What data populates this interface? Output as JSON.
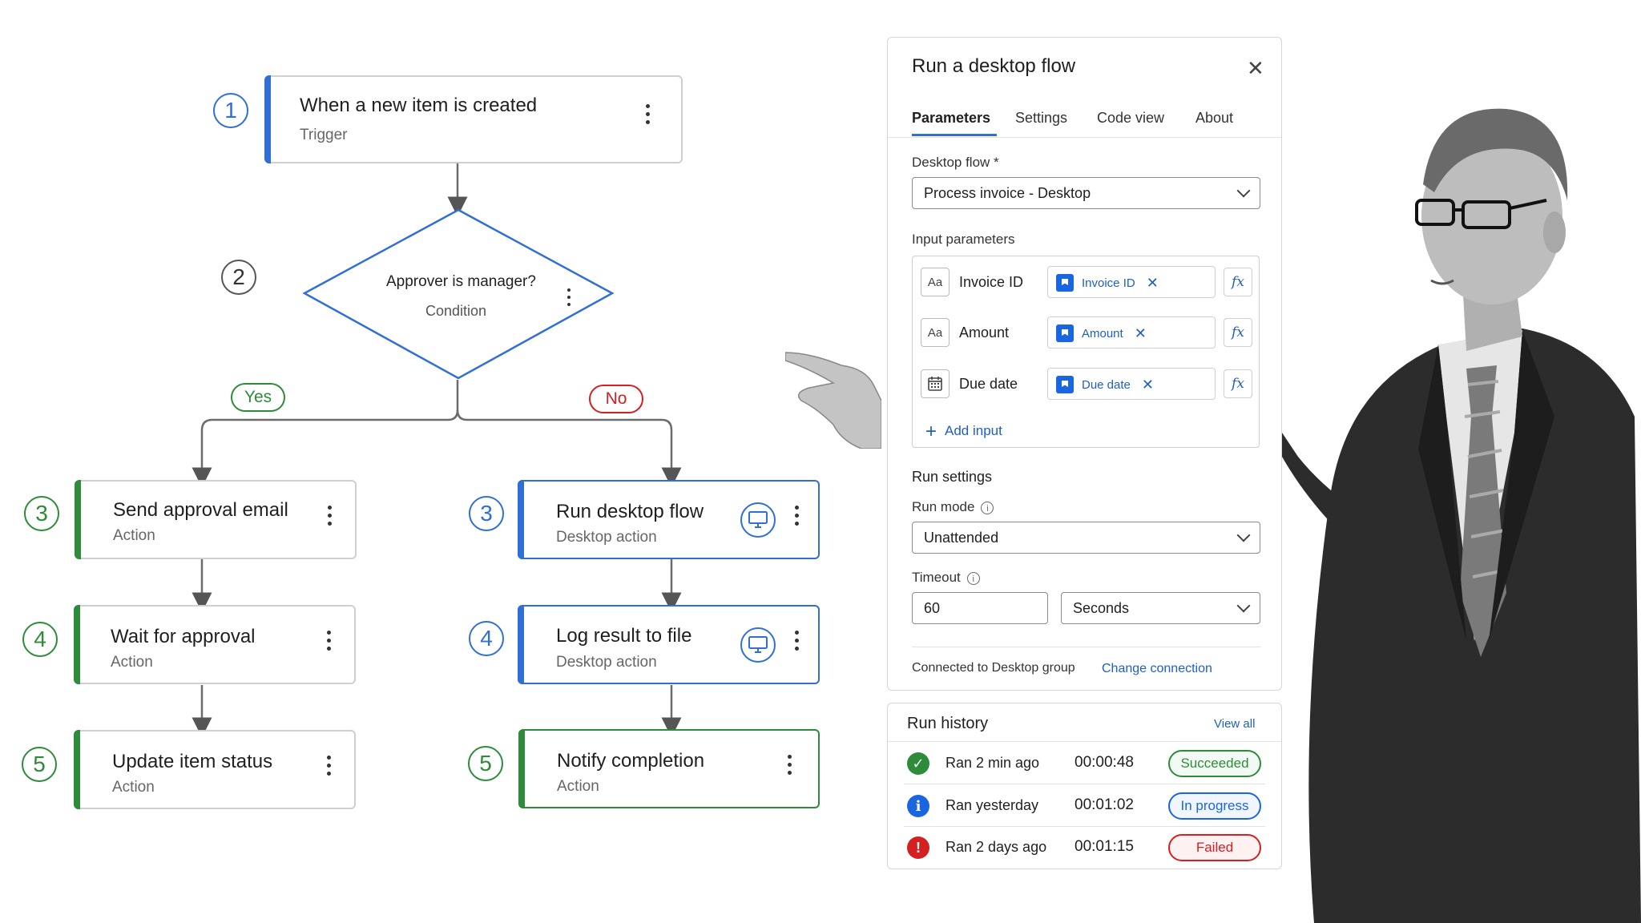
{
  "flow": {
    "trigger": {
      "step": "1",
      "title": "When a new item is created",
      "subtitle": "Trigger"
    },
    "condition": {
      "step": "2",
      "title": "Approver is manager?",
      "subtitle": "Condition"
    },
    "branch_yes": "Yes",
    "branch_no": "No",
    "yes_steps": [
      {
        "step": "3",
        "title": "Send approval email",
        "subtitle": "Action"
      },
      {
        "step": "4",
        "title": "Wait for approval",
        "subtitle": "Action"
      },
      {
        "step": "5",
        "title": "Update item status",
        "subtitle": "Action"
      }
    ],
    "no_steps": [
      {
        "step": "3",
        "title": "Run desktop flow",
        "subtitle": "Desktop action",
        "icon": "monitor-icon"
      },
      {
        "step": "4",
        "title": "Log result to file",
        "subtitle": "Desktop action",
        "icon": "monitor-icon"
      },
      {
        "step": "5",
        "title": "Notify completion",
        "subtitle": "Action"
      }
    ]
  },
  "panel": {
    "title": "Run a desktop flow",
    "close_icon": "close-icon",
    "tabs": [
      {
        "label": "Parameters",
        "active": true
      },
      {
        "label": "Settings",
        "active": false
      },
      {
        "label": "Code view",
        "active": false
      },
      {
        "label": "About",
        "active": false
      }
    ],
    "desktop_flow_label": "Desktop flow *",
    "desktop_flow_value": "Process invoice - Desktop",
    "input_parameters_label": "Input parameters",
    "inputs": [
      {
        "type_icon": "Aa",
        "name": "Invoice ID",
        "token": "Invoice ID",
        "fx": "fx"
      },
      {
        "type_icon": "Aa",
        "name": "Amount",
        "token": "Amount",
        "fx": "fx"
      },
      {
        "type_icon": "calendar-icon",
        "name": "Due date",
        "token": "Due date",
        "fx": "fx"
      }
    ],
    "add_input": "Add input",
    "run_settings_label": "Run settings",
    "run_mode_label": "Run mode",
    "run_mode_value": "Unattended",
    "timeout_label": "Timeout",
    "timeout_value": "60",
    "timeout_unit": "Seconds",
    "connection_text": "Connected to Desktop group",
    "change_connection": "Change connection"
  },
  "run_history": {
    "title": "Run history",
    "view_all": "View all",
    "runs": [
      {
        "when": "Ran 2 min ago",
        "duration": "00:00:48",
        "status": "Succeeded",
        "color": "#2e8b3a",
        "icon": "check-icon"
      },
      {
        "when": "Ran yesterday",
        "duration": "00:01:02",
        "status": "In progress",
        "color": "#1a66e0",
        "icon": "info-icon"
      },
      {
        "when": "Ran 2 days ago",
        "duration": "00:01:15",
        "status": "Failed",
        "color": "#d42020",
        "icon": "error-icon"
      }
    ]
  },
  "colors": {
    "blue": "#2f6fd6",
    "green": "#2e8b3a",
    "red": "#d42020"
  }
}
